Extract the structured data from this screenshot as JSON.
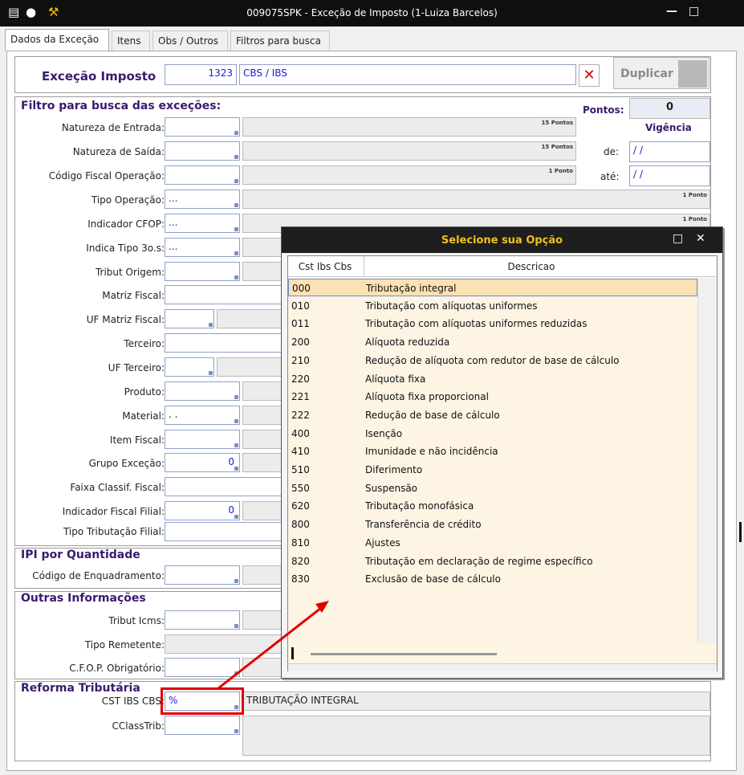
{
  "window": {
    "title": "009075SPK - Exceção de Imposto (1-Luiza Barcelos)"
  },
  "tabs": [
    "Dados da Exceção",
    "Itens",
    "Obs / Outros",
    "Filtros para busca"
  ],
  "header": {
    "label": "Exceção Imposto",
    "code": "1323",
    "description": "CBS / IBS",
    "duplicate_label": "Duplicar"
  },
  "filter": {
    "title": "Filtro para busca das exceções:",
    "pontos_label": "Pontos:",
    "pontos_value": "0",
    "vigencia_label": "Vigência",
    "de_label": "de:",
    "de_value": "/ /",
    "ate_label": "até:",
    "ate_value": "/ /",
    "pts15": "15 Pontos",
    "pts1": "1 Ponto",
    "fields": {
      "natureza_entrada": "Natureza de Entrada:",
      "natureza_saida": "Natureza de Saída:",
      "cfo": "Código Fiscal Operação:",
      "tipo_operacao": "Tipo Operação:",
      "tipo_operacao_val": "...",
      "indicador_cfop": "Indicador CFOP:",
      "indicador_cfop_val": "...",
      "indica_tipo": "Indica Tipo 3o.s:",
      "indica_tipo_val": "...",
      "tribut_origem": "Tribut Origem:",
      "matriz_fiscal": "Matriz Fiscal:",
      "uf_matriz": "UF Matriz Fiscal:",
      "terceiro": "Terceiro:",
      "uf_terceiro": "UF Terceiro:",
      "produto": "Produto:",
      "material": "Material:",
      "material_val": ". .",
      "item_fiscal": "Item Fiscal:",
      "grupo_excecao": "Grupo Exceção:",
      "grupo_excecao_val": "0",
      "faixa_classif": "Faixa Classif. Fiscal:",
      "indicador_fiscal": "Indicador Fiscal Filial:",
      "indicador_fiscal_val": "0",
      "tipo_tributacao": "Tipo Tributação Filial:"
    }
  },
  "ipi": {
    "title": "IPI por Quantidade",
    "codigo_label": "Código de Enquadramento:"
  },
  "outras": {
    "title": "Outras Informações",
    "tribut_icms": "Tribut Icms:",
    "tipo_remetente": "Tipo Remetente:",
    "cfop_obrig": "C.F.O.P. Obrigatório:"
  },
  "reforma": {
    "title": "Reforma Tributária",
    "cst_label": "CST IBS CBS:",
    "cst_value": "%",
    "cst_desc": "TRIBUTAÇÃO INTEGRAL",
    "cclass_label": "CClassTrib:"
  },
  "popup": {
    "title": "Selecione sua Opção",
    "col1": "Cst Ibs Cbs",
    "col2": "Descricao",
    "rows": [
      [
        "000",
        "Tributação integral"
      ],
      [
        "010",
        "Tributação com alíquotas uniformes"
      ],
      [
        "011",
        "Tributação com alíquotas uniformes reduzidas"
      ],
      [
        "200",
        "Alíquota reduzida"
      ],
      [
        "210",
        "Redução de alíquota com redutor de base de cálculo"
      ],
      [
        "220",
        "Alíquota fixa"
      ],
      [
        "221",
        "Alíquota fixa proporcional"
      ],
      [
        "222",
        "Redução de base de cálculo"
      ],
      [
        "400",
        "Isenção"
      ],
      [
        "410",
        "Imunidade e não incidência"
      ],
      [
        "510",
        "Diferimento"
      ],
      [
        "550",
        "Suspensão"
      ],
      [
        "620",
        "Tributação monofásica"
      ],
      [
        "800",
        "Transferência de crédito"
      ],
      [
        "810",
        "Ajustes"
      ],
      [
        "820",
        "Tributação em declaração de regime específico"
      ],
      [
        "830",
        "Exclusão de base de cálculo"
      ]
    ]
  },
  "colors": {
    "accent": "#3a1a6e",
    "annotation": "#e00000",
    "selected_row": "#fbe1b4"
  }
}
